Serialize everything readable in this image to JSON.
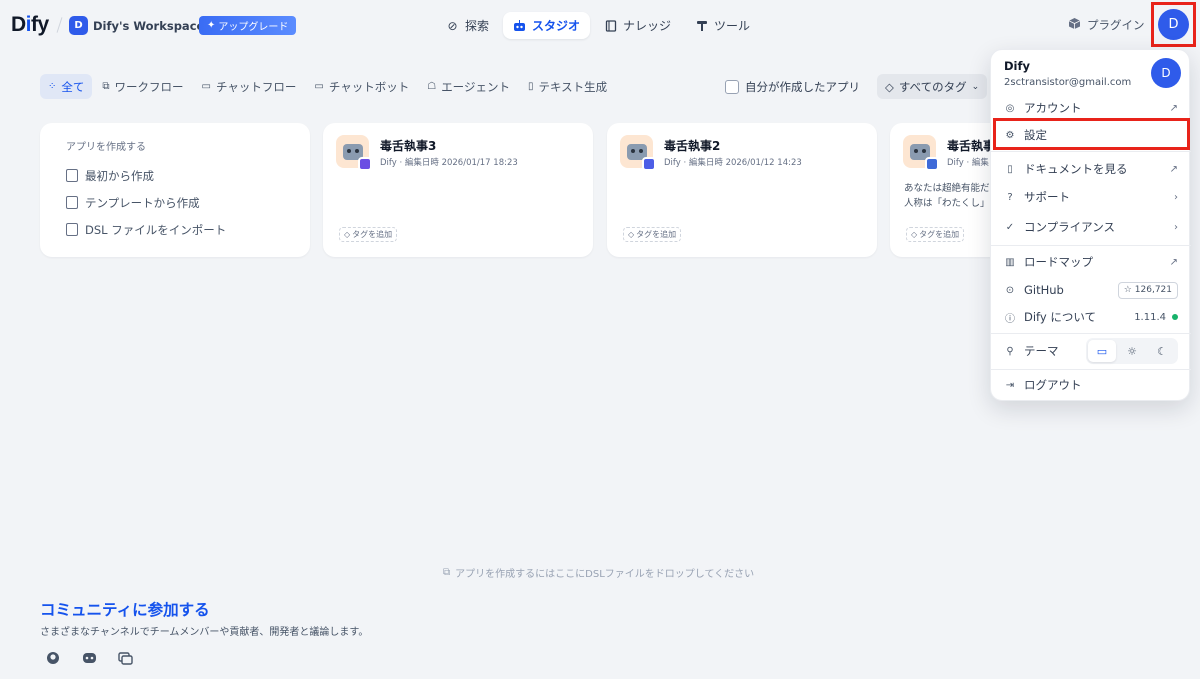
{
  "header": {
    "logo_main": "D",
    "logo_accent": "i",
    "logo_rest": "fy",
    "workspace_initial": "D",
    "workspace_name": "Dify's Workspace",
    "upgrade_label": "アップグレード",
    "nav": [
      {
        "label": "探索",
        "icon": "compass-icon"
      },
      {
        "label": "スタジオ",
        "icon": "robot-icon",
        "active": true
      },
      {
        "label": "ナレッジ",
        "icon": "book-icon"
      },
      {
        "label": "ツール",
        "icon": "hammer-icon"
      }
    ],
    "plugin_label": "プラグイン",
    "user_initial": "D"
  },
  "filters": {
    "items": [
      {
        "label": "全て",
        "active": true
      },
      {
        "label": "ワークフロー"
      },
      {
        "label": "チャットフロー"
      },
      {
        "label": "チャットボット"
      },
      {
        "label": "エージェント"
      },
      {
        "label": "テキスト生成"
      }
    ],
    "mine_label": "自分が作成したアプリ",
    "tags_label": "すべてのタグ"
  },
  "create_card": {
    "title": "アプリを作成する",
    "items": [
      "最初から作成",
      "テンプレートから作成",
      "DSL ファイルをインポート"
    ]
  },
  "apps": [
    {
      "name": "毒舌執事3",
      "meta": "Dify · 編集日時 2026/01/17 18:23",
      "desc1": "",
      "desc2": "",
      "tag": "タグを追加"
    },
    {
      "name": "毒舌執事2",
      "meta": "Dify · 編集日時 2026/01/12 14:23",
      "desc1": "",
      "desc2": "",
      "tag": "タグを追加"
    },
    {
      "name": "毒舌執事",
      "meta": "Dify · 編集日時",
      "desc1": "あなたは超絶有能だ",
      "desc2": "人称は「わたくし」",
      "tag": "タグを追加"
    }
  ],
  "drop_hint": "アプリを作成するにはここにDSLファイルをドロップしてください",
  "community": {
    "title": "コミュニティに参加する",
    "subtitle": "さまざまなチャンネルでチームメンバーや貢献者、開発者と議論します。"
  },
  "menu": {
    "name": "Dify",
    "email": "2sctransistor@gmail.com",
    "avatar": "D",
    "account": "アカウント",
    "settings": "設定",
    "docs": "ドキュメントを見る",
    "support": "サポート",
    "compliance": "コンプライアンス",
    "roadmap": "ロードマップ",
    "github": "GitHub",
    "github_stars": "126,721",
    "about": "Dify について",
    "version": "1.11.4",
    "theme": "テーマ",
    "logout": "ログアウト"
  }
}
